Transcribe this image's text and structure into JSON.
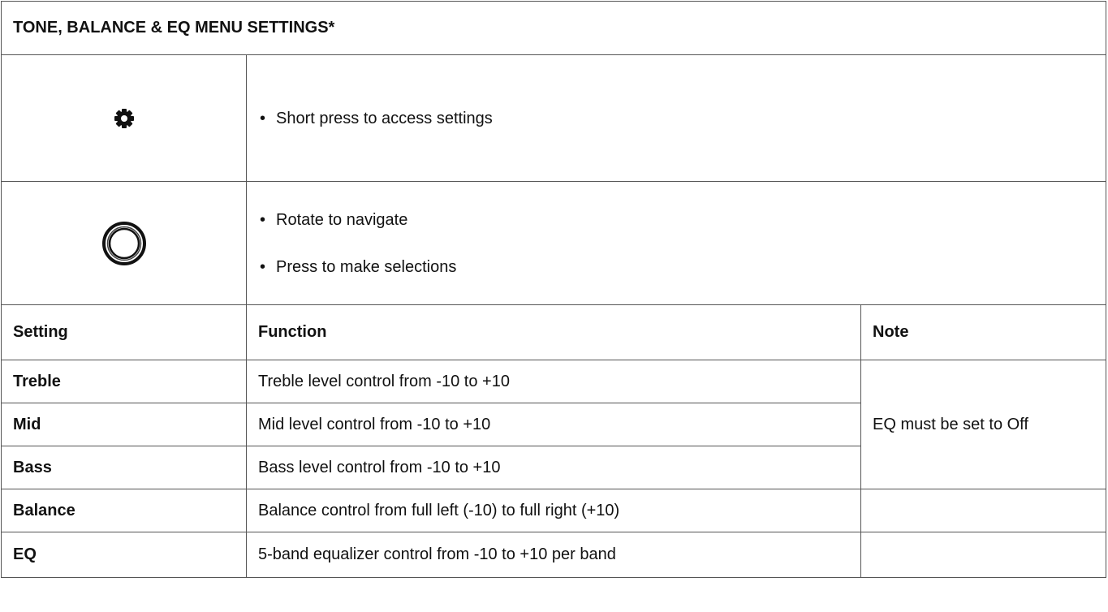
{
  "document": {
    "title": "TONE, BALANCE & EQ MENU SETTINGS*",
    "controls": [
      {
        "icon": "gear-icon",
        "bullets": [
          "Short press to access settings"
        ]
      },
      {
        "icon": "rotary-knob-icon",
        "bullets": [
          "Rotate to navigate",
          "Press to make selections"
        ]
      }
    ],
    "table": {
      "headers": {
        "setting": "Setting",
        "function": "Function",
        "note": "Note"
      },
      "rows": [
        {
          "setting": "Treble",
          "function": "Treble level control from -10 to +10"
        },
        {
          "setting": "Mid",
          "function": "Mid level control from -10 to +10"
        },
        {
          "setting": "Bass",
          "function": "Bass level control from -10 to +10"
        },
        {
          "setting": "Balance",
          "function": "Balance control from full left (-10) to full right (+10)",
          "note": ""
        },
        {
          "setting": "EQ",
          "function": "5-band equalizer control from -10 to +10 per band",
          "note": ""
        }
      ],
      "merged_note": "EQ must be set to Off"
    }
  }
}
